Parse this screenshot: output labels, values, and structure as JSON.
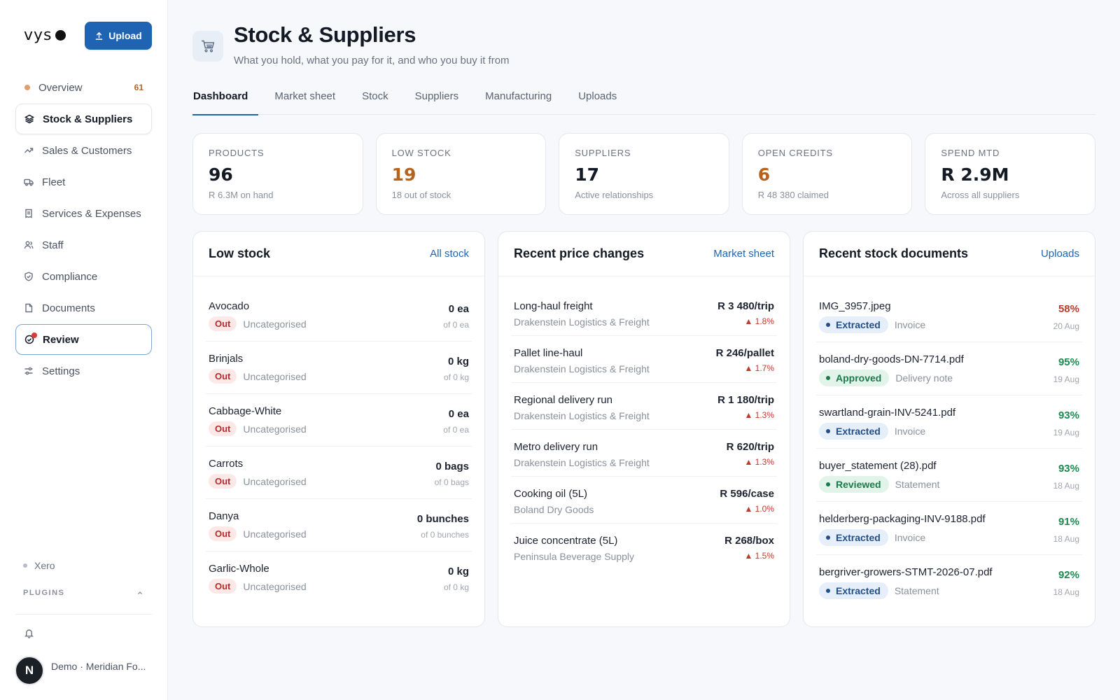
{
  "app": {
    "logo_text": "vys",
    "upload_label": "Upload"
  },
  "sidebar": {
    "items": [
      {
        "label": "Overview",
        "count": "61",
        "icon": "orange-dot"
      },
      {
        "label": "Stock & Suppliers",
        "icon": "layers-icon"
      },
      {
        "label": "Sales & Customers",
        "icon": "trend-icon"
      },
      {
        "label": "Fleet",
        "icon": "truck-icon"
      },
      {
        "label": "Services & Expenses",
        "icon": "receipt-icon"
      },
      {
        "label": "Staff",
        "icon": "people-icon"
      },
      {
        "label": "Compliance",
        "icon": "shield-icon"
      },
      {
        "label": "Documents",
        "icon": "document-icon"
      },
      {
        "label": "Review",
        "icon": "check-circle-icon"
      },
      {
        "label": "Settings",
        "icon": "sliders-icon"
      }
    ],
    "xero": "Xero",
    "plugins": "PLUGINS",
    "avatar_initial": "N",
    "org_name": "Demo · Meridian Fo..."
  },
  "header": {
    "title": "Stock & Suppliers",
    "subtitle": "What you hold, what you pay for it, and who you buy it from"
  },
  "tabs": [
    "Dashboard",
    "Market sheet",
    "Stock",
    "Suppliers",
    "Manufacturing",
    "Uploads"
  ],
  "stats": [
    {
      "label": "PRODUCTS",
      "value": "96",
      "sub": "R 6.3M on hand"
    },
    {
      "label": "LOW STOCK",
      "value": "19",
      "sub": "18 out of stock"
    },
    {
      "label": "SUPPLIERS",
      "value": "17",
      "sub": "Active relationships"
    },
    {
      "label": "OPEN CREDITS",
      "value": "6",
      "sub": "R 48 380 claimed"
    },
    {
      "label": "SPEND MTD",
      "value": "R 2.9M",
      "sub": "Across all suppliers"
    }
  ],
  "low_stock": {
    "title": "Low stock",
    "link": "All stock",
    "rows": [
      {
        "name": "Avocado",
        "status": "Out",
        "category": "Uncategorised",
        "qty": "0 ea",
        "of": "of 0 ea"
      },
      {
        "name": "Brinjals",
        "status": "Out",
        "category": "Uncategorised",
        "qty": "0 kg",
        "of": "of 0 kg"
      },
      {
        "name": "Cabbage-White",
        "status": "Out",
        "category": "Uncategorised",
        "qty": "0 ea",
        "of": "of 0 ea"
      },
      {
        "name": "Carrots",
        "status": "Out",
        "category": "Uncategorised",
        "qty": "0 bags",
        "of": "of 0 bags"
      },
      {
        "name": "Danya",
        "status": "Out",
        "category": "Uncategorised",
        "qty": "0 bunches",
        "of": "of 0 bunches"
      },
      {
        "name": "Garlic-Whole",
        "status": "Out",
        "category": "Uncategorised",
        "qty": "0 kg",
        "of": "of 0 kg"
      }
    ]
  },
  "price_changes": {
    "title": "Recent price changes",
    "link": "Market sheet",
    "rows": [
      {
        "name": "Long-haul freight",
        "supplier": "Drakenstein Logistics & Freight",
        "price": "R 3 480/trip",
        "change": "▲ 1.8%"
      },
      {
        "name": "Pallet line-haul",
        "supplier": "Drakenstein Logistics & Freight",
        "price": "R 246/pallet",
        "change": "▲ 1.7%"
      },
      {
        "name": "Regional delivery run",
        "supplier": "Drakenstein Logistics & Freight",
        "price": "R 1 180/trip",
        "change": "▲ 1.3%"
      },
      {
        "name": "Metro delivery run",
        "supplier": "Drakenstein Logistics & Freight",
        "price": "R 620/trip",
        "change": "▲ 1.3%"
      },
      {
        "name": "Cooking oil (5L)",
        "supplier": "Boland Dry Goods",
        "price": "R 596/case",
        "change": "▲ 1.0%"
      },
      {
        "name": "Juice concentrate (5L)",
        "supplier": "Peninsula Beverage Supply",
        "price": "R 268/box",
        "change": "▲ 1.5%"
      }
    ]
  },
  "documents": {
    "title": "Recent stock documents",
    "link": "Uploads",
    "rows": [
      {
        "name": "IMG_3957.jpeg",
        "status": "Extracted",
        "type": "Invoice",
        "pct": "58%",
        "date": "20 Aug",
        "tone": "red"
      },
      {
        "name": "boland-dry-goods-DN-7714.pdf",
        "status": "Approved",
        "type": "Delivery note",
        "pct": "95%",
        "date": "19 Aug",
        "tone": "green"
      },
      {
        "name": "swartland-grain-INV-5241.pdf",
        "status": "Extracted",
        "type": "Invoice",
        "pct": "93%",
        "date": "19 Aug",
        "tone": "green"
      },
      {
        "name": "buyer_statement (28).pdf",
        "status": "Reviewed",
        "type": "Statement",
        "pct": "93%",
        "date": "18 Aug",
        "tone": "green"
      },
      {
        "name": "helderberg-packaging-INV-9188.pdf",
        "status": "Extracted",
        "type": "Invoice",
        "pct": "91%",
        "date": "18 Aug",
        "tone": "green"
      },
      {
        "name": "bergriver-growers-STMT-2026-07.pdf",
        "status": "Extracted",
        "type": "Statement",
        "pct": "92%",
        "date": "18 Aug",
        "tone": "green"
      }
    ]
  },
  "colors": {
    "accent": "#1f64b3",
    "warn": "#b5621f",
    "danger": "#c0392b",
    "success": "#1b8a4f"
  }
}
